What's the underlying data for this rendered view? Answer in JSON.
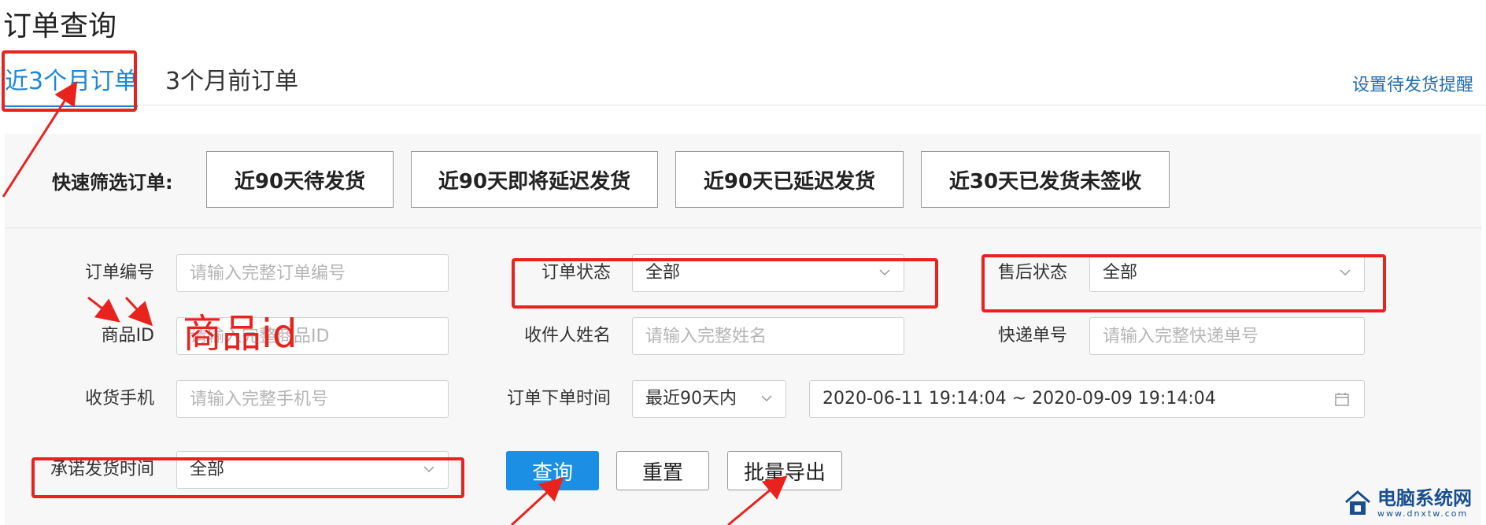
{
  "page": {
    "title": "订单查询"
  },
  "tabs": [
    {
      "label": "近3个月订单",
      "active": true
    },
    {
      "label": "3个月前订单",
      "active": false
    }
  ],
  "header": {
    "reminder_link": "设置待发货提醒"
  },
  "quick_filter": {
    "label": "快速筛选订单:",
    "buttons": [
      "近90天待发货",
      "近90天即将延迟发货",
      "近90天已延迟发货",
      "近30天已发货未签收"
    ]
  },
  "form": {
    "order_number": {
      "label": "订单编号",
      "placeholder": "请输入完整订单编号"
    },
    "product_id": {
      "label": "商品ID",
      "placeholder": "请输入完整商品ID"
    },
    "phone": {
      "label": "收货手机",
      "placeholder": "请输入完整手机号"
    },
    "promise_time": {
      "label": "承诺发货时间",
      "value": "全部"
    },
    "order_status": {
      "label": "订单状态",
      "value": "全部"
    },
    "recipient_name": {
      "label": "收件人姓名",
      "placeholder": "请输入完整姓名"
    },
    "order_time": {
      "label": "订单下单时间",
      "range_value": "最近90天内",
      "date_range": "2020-06-11 19:14:04 ~ 2020-09-09 19:14:04"
    },
    "after_sale_status": {
      "label": "售后状态",
      "value": "全部"
    },
    "tracking_number": {
      "label": "快递单号",
      "placeholder": "请输入完整快递单号"
    }
  },
  "actions": {
    "query": "查询",
    "reset": "重置",
    "export": "批量导出"
  },
  "annotation": {
    "text": "商品id"
  },
  "watermark": {
    "title": "电脑系统网",
    "url": "www.dnxtw.com"
  },
  "colors": {
    "accent": "#1a8fe3",
    "tab_active": "#1a87d8",
    "annotation": "#e8231e",
    "link": "#1f6db3"
  },
  "icons": {
    "select": "chevron-down-icon",
    "date": "calendar-icon",
    "watermark": "house-icon"
  }
}
